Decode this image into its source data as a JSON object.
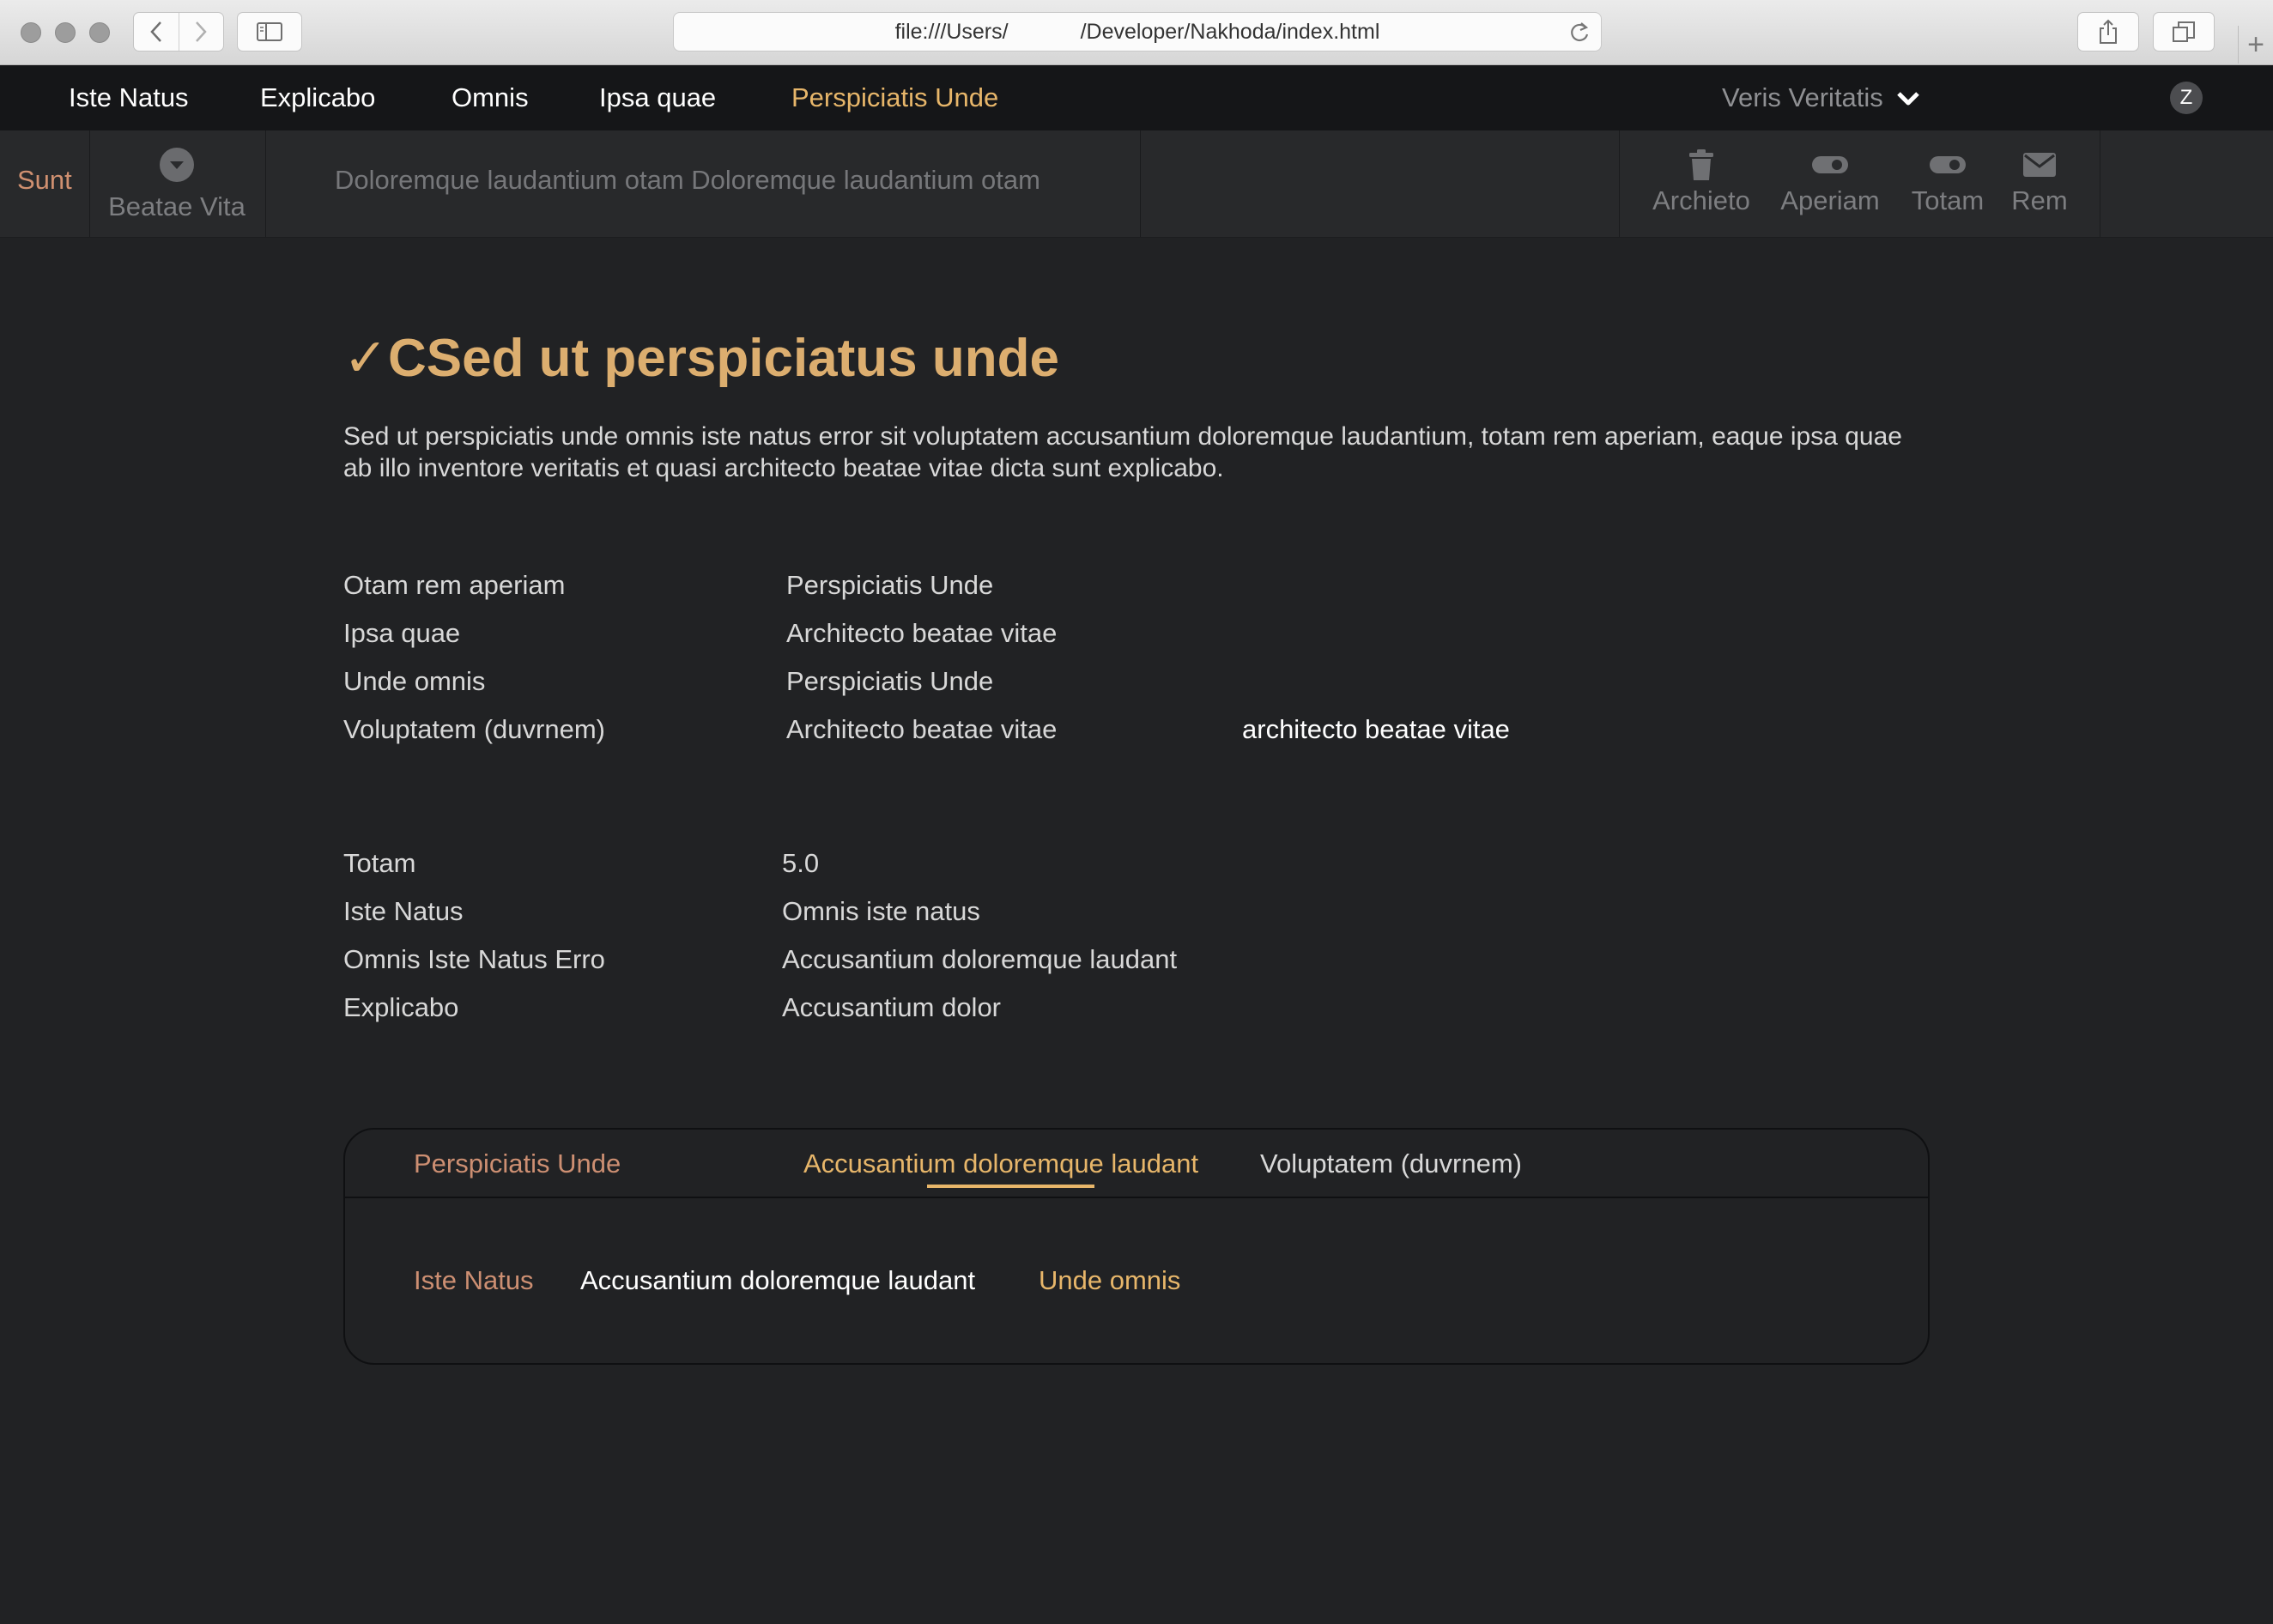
{
  "browser": {
    "url_prefix": "file:///Users/",
    "url_suffix": "/Developer/Nakhoda/index.html",
    "new_tab": "+"
  },
  "nav": {
    "items": [
      "Iste Natus",
      "Explicabo",
      "Omnis",
      "Ipsa quae",
      "Perspiciatis Unde"
    ],
    "active_index": 4,
    "user_menu": "Veris Veritatis",
    "avatar_letter": "Z"
  },
  "toolbar": {
    "left_label": "Sunt",
    "dropdown_label": "Beatae Vita",
    "search_placeholder": "Doloremque laudantium otam Doloremque laudantium otam",
    "actions": [
      {
        "label": "Archieto",
        "icon": "trash-icon"
      },
      {
        "label": "Aperiam",
        "icon": "toggle-icon"
      },
      {
        "label": "Totam",
        "icon": "toggle-icon"
      },
      {
        "label": "Rem",
        "icon": "mail-icon"
      }
    ]
  },
  "main": {
    "title_check": "✓",
    "title": "CSed ut perspiciatus unde",
    "description": "Sed ut perspiciatis unde omnis iste natus error sit voluptatem accusantium doloremque laudantium, totam rem aperiam, eaque ipsa quae ab illo inventore veritatis et quasi architecto beatae vitae dicta sunt explicabo.",
    "details_1": [
      {
        "label": "Otam rem aperiam",
        "value": "Perspiciatis Unde"
      },
      {
        "label": "Ipsa quae",
        "value": "Architecto beatae vitae"
      },
      {
        "label": "Unde omnis",
        "value": "Perspiciatis Unde"
      },
      {
        "label": "Voluptatem (duvrnem)",
        "value": "Architecto beatae vitae",
        "extra": "architecto beatae vitae"
      }
    ],
    "details_2": [
      {
        "label": "Totam",
        "value": "5.0"
      },
      {
        "label": "Iste Natus",
        "value": "Omnis iste natus"
      },
      {
        "label": "Omnis Iste Natus Erro",
        "value": "Accusantium doloremque laudant"
      },
      {
        "label": "Explicabo",
        "value": "Accusantium dolor"
      }
    ]
  },
  "tabs": {
    "items": [
      "Perspiciatis Unde",
      "Accusantium doloremque laudant",
      "Voluptatem (duvrnem)"
    ],
    "active_index": 1,
    "body": [
      "Iste Natus",
      "Accusantium doloremque laudant",
      "Unde omnis"
    ]
  }
}
